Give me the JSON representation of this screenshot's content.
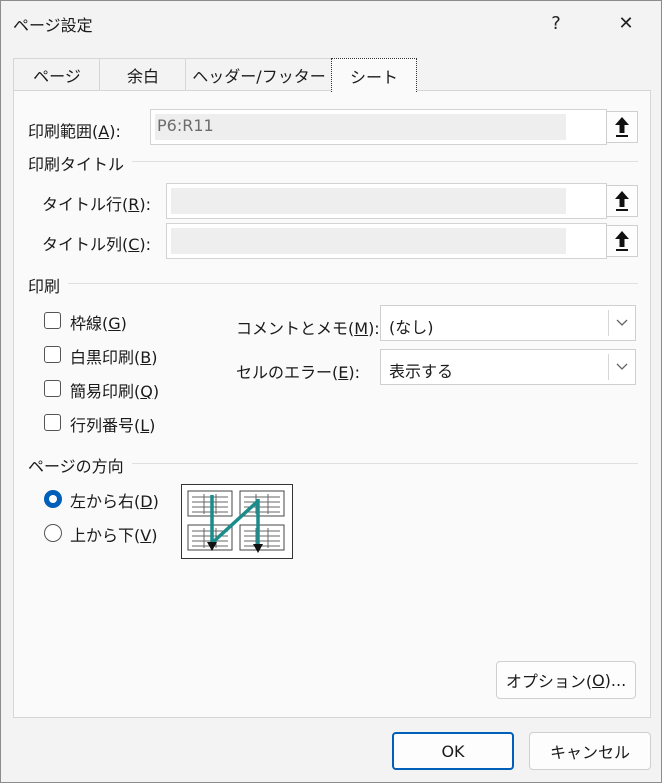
{
  "window": {
    "title": "ページ設定",
    "help_glyph": "?",
    "close_glyph": "✕"
  },
  "tabs": [
    {
      "label": "ページ",
      "active": false
    },
    {
      "label": "余白",
      "active": false
    },
    {
      "label": "ヘッダー/フッター",
      "active": false
    },
    {
      "label": "シート",
      "active": true
    }
  ],
  "print_area": {
    "label": "印刷範囲(",
    "key": "A",
    "suffix": "):",
    "value": "P6:R11"
  },
  "print_titles": {
    "heading": "印刷タイトル",
    "rows": {
      "label": "タイトル行(",
      "key": "R",
      "suffix": "):",
      "value": ""
    },
    "cols": {
      "label": "タイトル列(",
      "key": "C",
      "suffix": "):",
      "value": ""
    }
  },
  "print": {
    "heading": "印刷",
    "options": [
      {
        "label": "枠線(",
        "key": "G",
        "suffix": ")",
        "checked": false
      },
      {
        "label": "白黒印刷(",
        "key": "B",
        "suffix": ")",
        "checked": false
      },
      {
        "label": "簡易印刷(",
        "key": "Q",
        "suffix": ")",
        "checked": false
      },
      {
        "label": "行列番号(",
        "key": "L",
        "suffix": ")",
        "checked": false
      }
    ],
    "comments": {
      "label": "コメントとメモ(",
      "key": "M",
      "suffix": "):",
      "value": "(なし)"
    },
    "errors": {
      "label": "セルのエラー(",
      "key": "E",
      "suffix": "):",
      "value": "表示する"
    }
  },
  "page_order": {
    "heading": "ページの方向",
    "options": [
      {
        "label": "左から右(",
        "key": "D",
        "suffix": ")",
        "selected": true
      },
      {
        "label": "上から下(",
        "key": "V",
        "suffix": ")",
        "selected": false
      }
    ]
  },
  "buttons": {
    "options": {
      "label": "オプション(",
      "key": "O",
      "suffix": ")..."
    },
    "ok": "OK",
    "cancel": "キャンセル"
  },
  "colors": {
    "accent": "#005fb8",
    "arrow": "#1a8c8c"
  }
}
